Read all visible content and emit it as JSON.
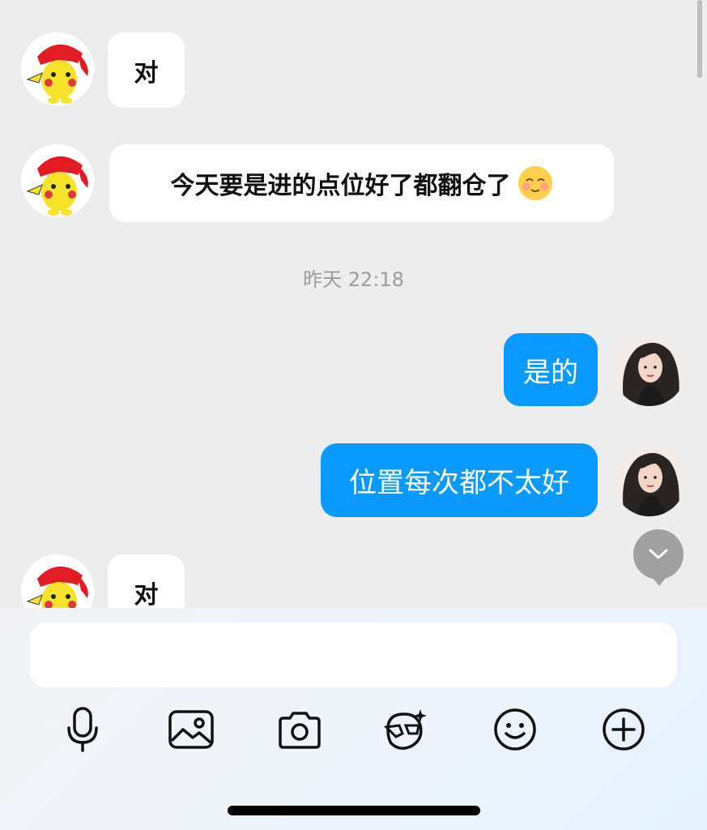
{
  "messages": [
    {
      "side": "in",
      "text": "对"
    },
    {
      "side": "in",
      "text": "今天要是进的点位好了都翻仓了",
      "emoji": "smiling-emoji-icon"
    },
    {
      "side": "out",
      "text": "是的"
    },
    {
      "side": "out",
      "text": "位置每次都不太好"
    },
    {
      "side": "in",
      "text": "对"
    }
  ],
  "timestamp": "昨天 22:18",
  "composer": {
    "value": "",
    "placeholder": ""
  },
  "toolbar": [
    "microphone-icon",
    "image-icon",
    "camera-icon",
    "sticker-icon",
    "emoji-icon",
    "plus-icon"
  ],
  "colors": {
    "outgoing_bubble": "#0a99ff",
    "incoming_bubble": "#ffffff",
    "background": "#ededed"
  }
}
